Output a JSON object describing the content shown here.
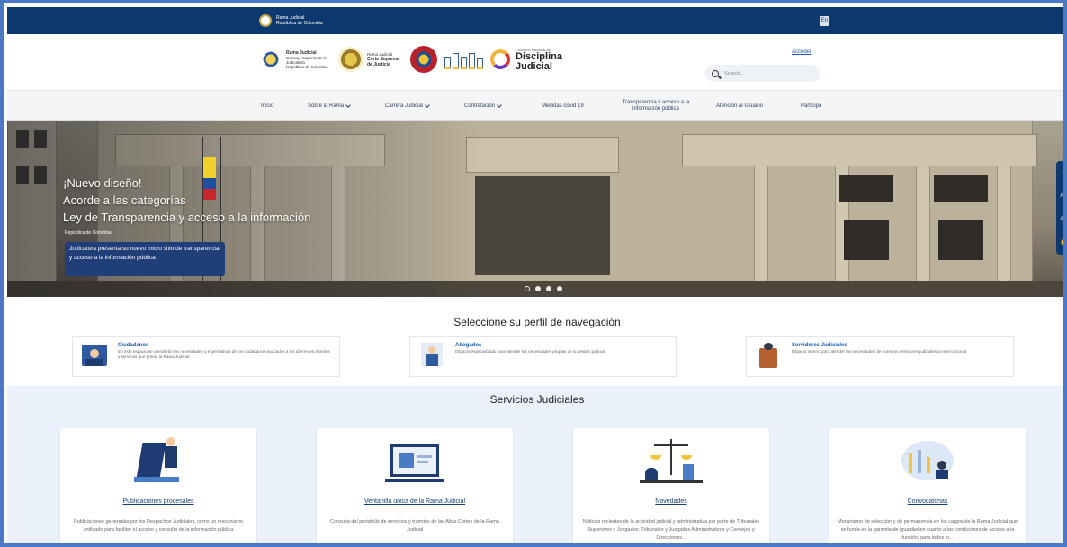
{
  "topbar": {
    "gov_line1": "Rama Judicial",
    "gov_line2": "República de Colombia",
    "lang_label": "En"
  },
  "header": {
    "logo1": {
      "line1": "Rama Judicial",
      "line2": "Consejo Superior de la Judicatura",
      "line3": "República de Colombia"
    },
    "logo2": {
      "line1": "Rama Judicial",
      "line2": "Corte Suprema de Justicia"
    },
    "disciplina": {
      "small": "Comisión Nacional de",
      "name1": "Disciplina",
      "name2": "Judicial"
    },
    "access_link": "Acceder",
    "search_placeholder": "Search..."
  },
  "nav": {
    "items": [
      {
        "label": "Inicio"
      },
      {
        "label": "Sobre la Rama"
      },
      {
        "label": "Carrera Judicial"
      },
      {
        "label": "Contratación"
      },
      {
        "label": "Medidas covid 19"
      },
      {
        "label": "Transparencia y acceso a la información pública"
      },
      {
        "label": "Atención al Usuario"
      },
      {
        "label": "Participa"
      }
    ]
  },
  "hero": {
    "line1": "¡Nuevo diseño!",
    "line2": "Acorde a las categorías",
    "line3": "Ley de Transparencia y acceso a la información",
    "small": "República de Colombia",
    "box": "Judicatura presenta su nuevo micro sitio de transparencia y acceso a la información pública"
  },
  "profile": {
    "heading": "Seleccione su perfil de navegación",
    "cards": [
      {
        "title": "Ciudadanos",
        "desc": "En este espacio se atenderán las necesidades y expectativas de los ciudadanos asociados a los diferentes trámites y servicios que presta la Rama Judicial"
      },
      {
        "title": "Abogados",
        "desc": "Espacio especializado para atender las necesidades propias de la gestión judicial"
      },
      {
        "title": "Servidores Judiciales",
        "desc": "Espacio interno para atender las necesidades de nuestros servidores judiciales a nivel nacional"
      }
    ]
  },
  "services": {
    "heading": "Servicios Judiciales",
    "cards": [
      {
        "title": "Publicaciones procesales",
        "desc": "Publicaciones generadas por los Despachos Judiciales, como un mecanismo unificado para facilitar el acceso y consulta de la información pública"
      },
      {
        "title": "Ventanilla única de la Rama Judicial",
        "desc": "Consulta del portafolio de servicios y trámites de las Altas Cortes de la Rama Judicial"
      },
      {
        "title": "Novedades",
        "desc": "Noticias recientes de la actividad judicial y administrativa por parte de Tribunales Superiores y Juzgados; Tribunales y Juzgados Administrativos y Consejos y Direcciones..."
      },
      {
        "title": "Convocatorias",
        "desc": "Mecanismo de selección y de permanencia en los cargos de la Rama Judicial que se funda en la garantía de igualdad en cuanto a las condiciones de acceso a la función, para todos lo..."
      }
    ]
  },
  "colors": {
    "topbar": "#0d3a6e",
    "accent": "#1a5bb5",
    "services_bg": "#eaf1fa"
  }
}
